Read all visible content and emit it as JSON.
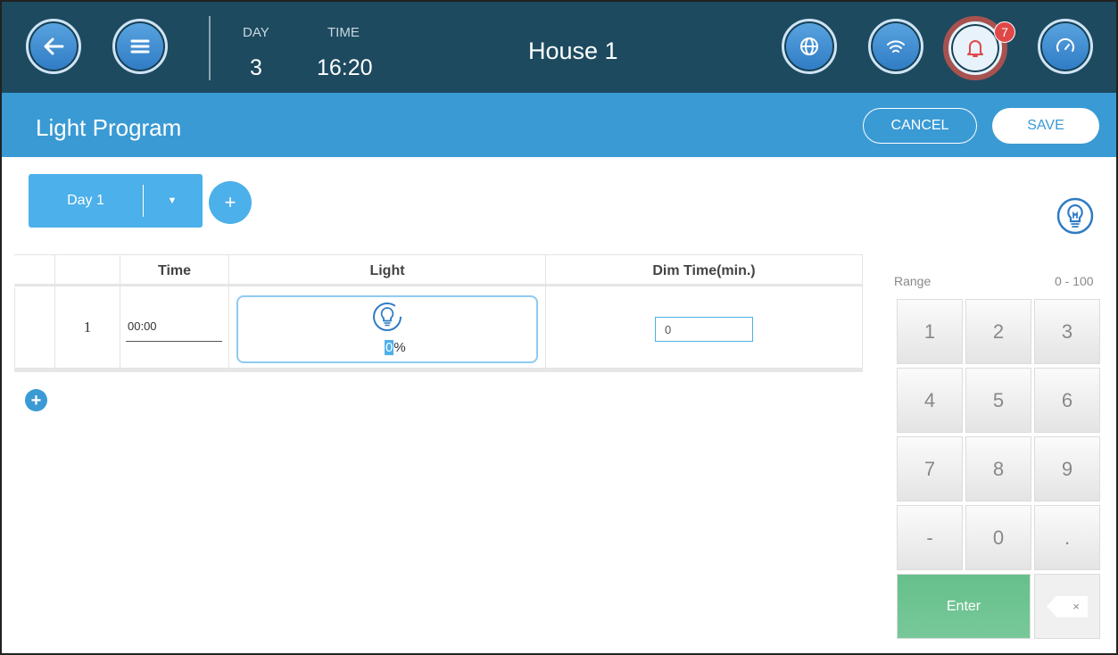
{
  "header": {
    "day_label": "DAY",
    "day_value": "3",
    "time_label": "TIME",
    "time_value": "16:20",
    "house_name": "House 1",
    "alarm_count": "7"
  },
  "titlebar": {
    "title": "Light Program",
    "cancel_label": "CANCEL",
    "save_label": "SAVE"
  },
  "day_selector": {
    "selected": "Day 1",
    "add_label": "+"
  },
  "table": {
    "columns": [
      "",
      "",
      "Time",
      "Light",
      "Dim Time(min.)"
    ],
    "rows": [
      {
        "index": "1",
        "time": "00:00",
        "light_value": "0",
        "light_unit": "%",
        "dim_time": "0"
      }
    ]
  },
  "keypad": {
    "range_label": "Range",
    "range_value": "0 - 100",
    "keys": [
      "1",
      "2",
      "3",
      "4",
      "5",
      "6",
      "7",
      "8",
      "9",
      "-",
      "0",
      "."
    ],
    "enter_label": "Enter",
    "backspace_label": "×"
  },
  "colors": {
    "topbar": "#1d4a5f",
    "titlebar": "#3a9ad4",
    "accent": "#4cb0ea",
    "enter": "#6cc490",
    "alarm": "#e04848"
  }
}
